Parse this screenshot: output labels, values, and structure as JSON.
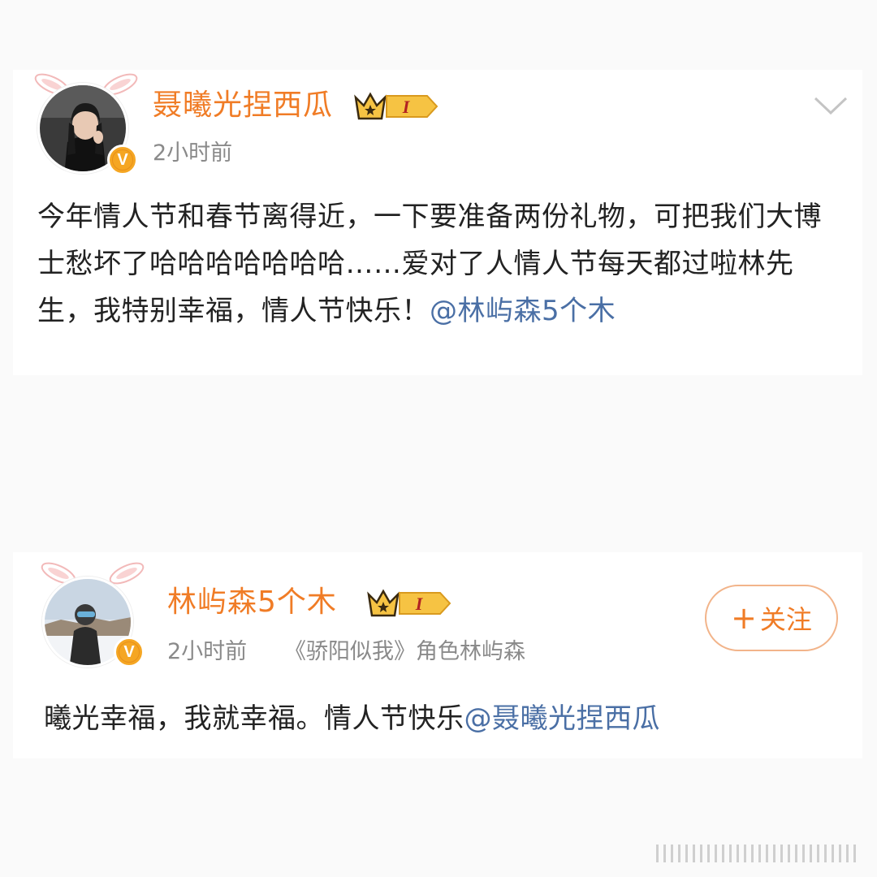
{
  "posts": [
    {
      "username": "聂曦光捏西瓜",
      "vip_level": "I",
      "timestamp": "2小时前",
      "source": "",
      "body_text": "今年情人节和春节离得近，一下要准备两份礼物，可把我们大博士愁坏了哈哈哈哈哈哈哈……爱对了人情人节每天都过啦林先生，我特别幸福，情人节快乐！",
      "mention": "@林屿森5个木",
      "avatar_badge": "V",
      "menu_icon": "chevron-down-icon"
    },
    {
      "username": "林屿森5个木",
      "vip_level": "I",
      "timestamp": "2小时前",
      "source": "《骄阳似我》角色林屿森",
      "body_text": "曦光幸福，我就幸福。情人节快乐",
      "mention": "@聂曦光捏西瓜",
      "avatar_badge": "V",
      "follow_plus": "+",
      "follow_label": "关注"
    }
  ],
  "colors": {
    "username": "#f07c26",
    "mention": "#4a6fa5",
    "text": "#222222",
    "meta": "#8a8a8a",
    "background": "#fafafa",
    "card": "#ffffff"
  }
}
